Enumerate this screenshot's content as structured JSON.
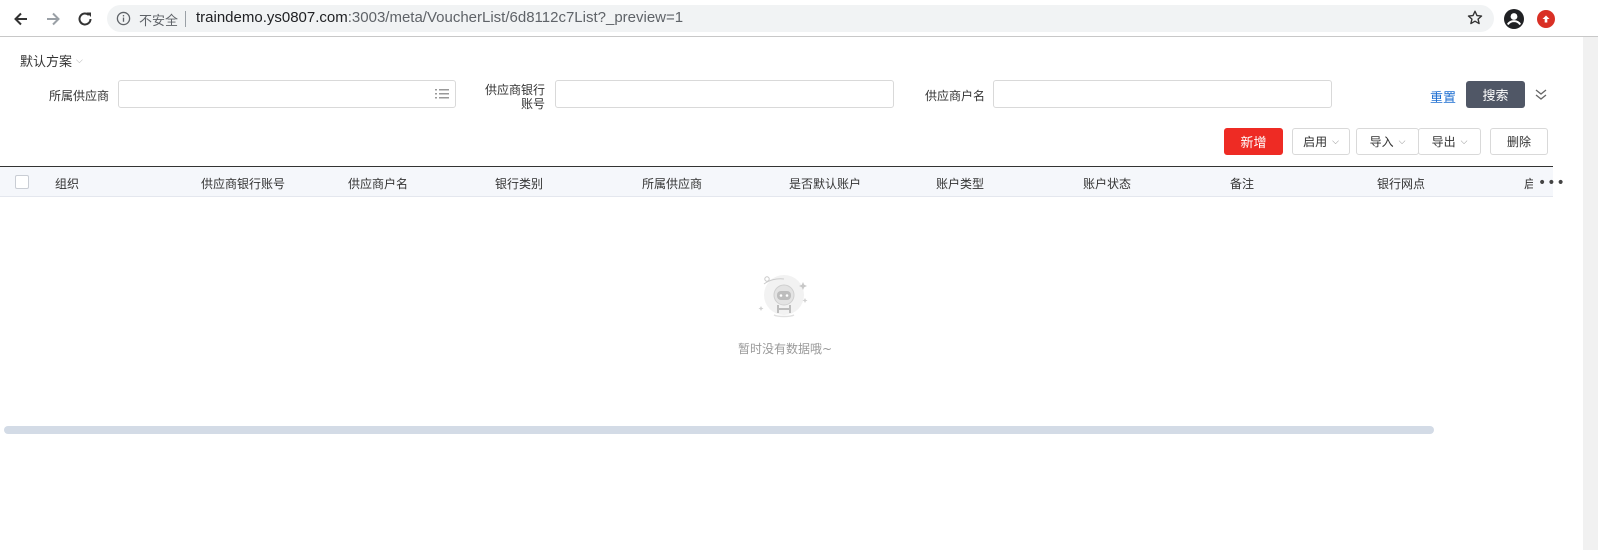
{
  "browser": {
    "insecure_label": "不安全",
    "url_host": "traindemo.ys0807.com",
    "url_rest": ":3003/meta/VoucherList/6d8112c7List?_preview=1"
  },
  "scheme": {
    "label": "默认方案"
  },
  "filters": {
    "supplier_label": "所属供应商",
    "bank_account_label": "供应商银行账号",
    "account_name_label": "供应商户名",
    "reset_label": "重置",
    "search_label": "搜索"
  },
  "toolbar": {
    "add_label": "新增",
    "enable_label": "启用",
    "import_label": "导入",
    "export_label": "导出",
    "delete_label": "删除"
  },
  "table": {
    "columns": [
      "组织",
      "供应商银行账号",
      "供应商户名",
      "银行类别",
      "所属供应商",
      "是否默认账户",
      "账户类型",
      "账户状态",
      "备注",
      "银行网点",
      "启"
    ]
  },
  "empty": {
    "text": "暂时没有数据哦~"
  },
  "colors": {
    "primary_red": "#ee2b24",
    "search_button": "#505766",
    "link_blue": "#1f6fd1"
  }
}
